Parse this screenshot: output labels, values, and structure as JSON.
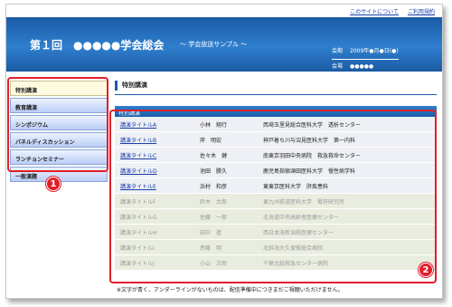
{
  "toplinks": [
    "このサイトについて",
    "ご利用規約"
  ],
  "header": {
    "title": "第１回　●●●●●学会総会",
    "subtitle": "〜 学会放送サンプル 〜",
    "date_label": "会期",
    "date_value": "2009年●月●日(●)",
    "venue_label": "会場",
    "venue_value": "●●●●●"
  },
  "sidebar": {
    "items": [
      {
        "label": "特別講演"
      },
      {
        "label": "教育講演"
      },
      {
        "label": "シンポジウム"
      },
      {
        "label": "パネルディスカッション"
      },
      {
        "label": "ランチョンセミナー"
      },
      {
        "label": "一般演題"
      }
    ]
  },
  "main": {
    "section_title": "特別講演",
    "table_header": "特別講演",
    "rows": [
      {
        "title": "講演タイトルA",
        "name": "小林　翔行",
        "org": "西埼玉里見総合医科大学　透析センター",
        "active": true
      },
      {
        "title": "講演タイトルB",
        "name": "岸　明宏",
        "org": "神戸着ち川与沼見医科大学　第一内科",
        "active": true
      },
      {
        "title": "講演タイトルC",
        "name": "佐々木　健",
        "org": "南東京羽田中央病院　救急救命センター",
        "active": true
      },
      {
        "title": "講演タイトルD",
        "name": "池田　勝久",
        "org": "鹿児島指宿頌田医科大学　慢性病学科",
        "active": true
      },
      {
        "title": "講演タイトルE",
        "name": "浜村　和彦",
        "org": "東東京医科大学　肝疾患科",
        "active": true
      },
      {
        "title": "講演タイトルF",
        "name": "鈴木　太郎",
        "org": "東九州鉄道医科大学　腎肝研究所",
        "active": false
      },
      {
        "title": "講演タイトルG",
        "name": "佐藤　一郎",
        "org": "北海道中央高齢者医療センター",
        "active": false
      },
      {
        "title": "講演タイトルH",
        "name": "田中　進",
        "org": "西日本海新潟県医療センター",
        "active": false
      },
      {
        "title": "講演タイトルI",
        "name": "斉藤　明",
        "org": "北斜海大久保腎総合病院",
        "active": false
      },
      {
        "title": "講演タイトルJ",
        "name": "小山　次郎",
        "org": "千葉北総救急センター病院",
        "active": false
      }
    ]
  },
  "note": "※文字が青く、アンダーラインがないものは、配信準備中につきまだご視聴いただけません。",
  "badges": [
    "1",
    "2"
  ]
}
